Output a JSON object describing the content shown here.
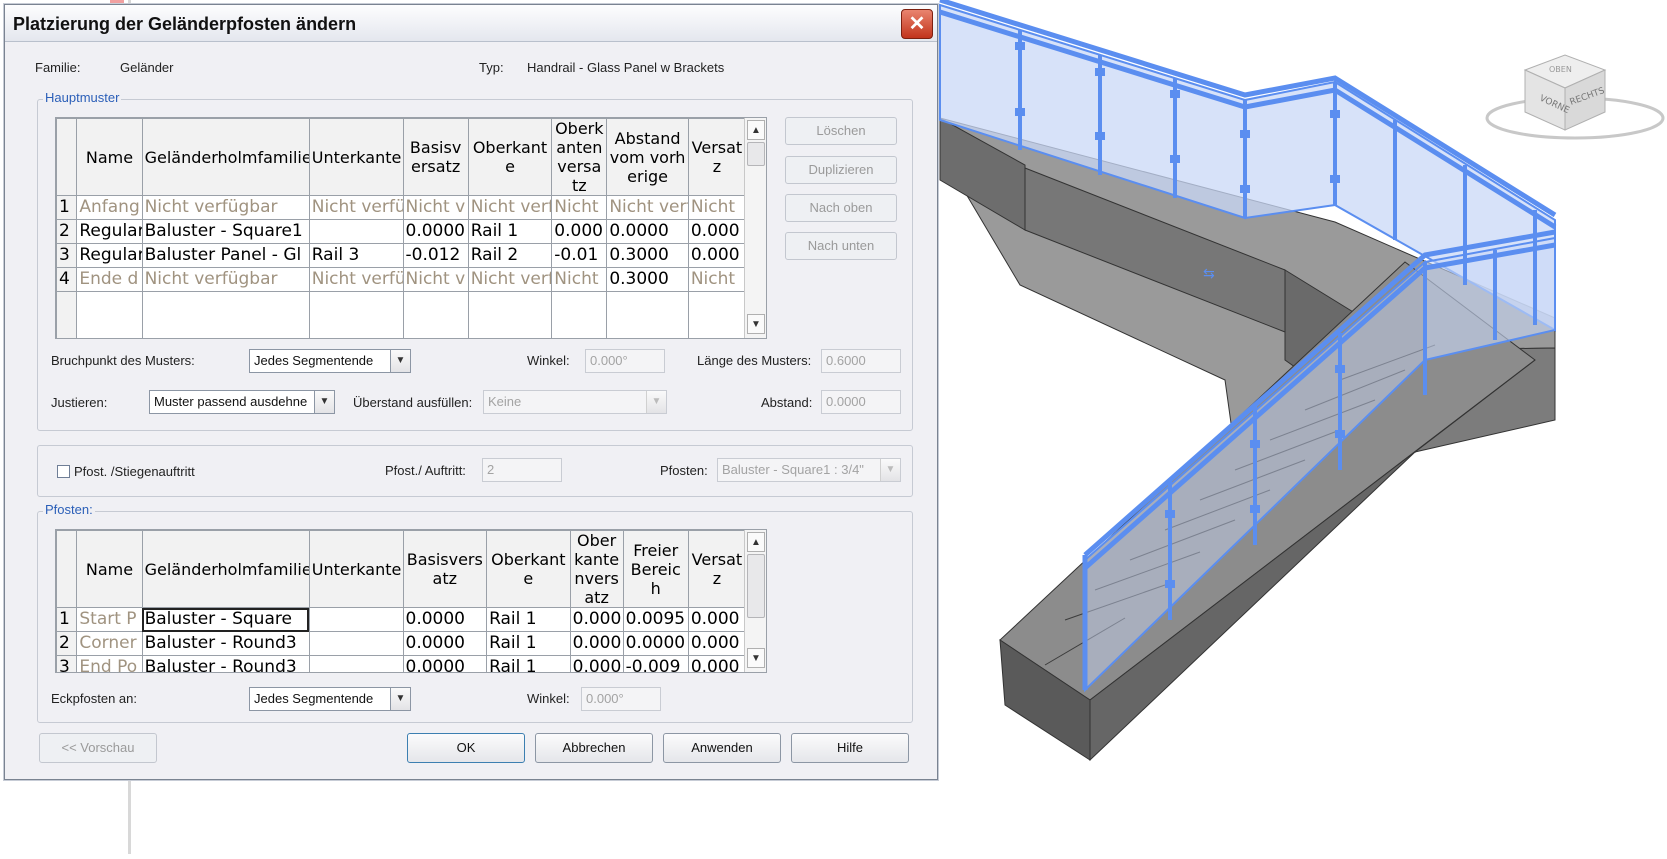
{
  "dialog": {
    "title": "Platzierung der Geländerpfosten ändern",
    "close_icon": "close-icon",
    "familie_label": "Familie:",
    "familie_value": "Geländer",
    "typ_label": "Typ:",
    "typ_value": "Handrail - Glass Panel w Brackets"
  },
  "hauptmuster": {
    "title": "Hauptmuster",
    "columns": [
      "",
      "Name",
      "Geländerholmfamilie",
      "Unterkante",
      "Basisversatz",
      "Oberkante",
      "Oberkantenversatz",
      "Abstand vom vorherige",
      "Versatz"
    ],
    "rows": [
      {
        "num": "1",
        "cells": [
          "Anfang",
          "Nicht verfügbar",
          "Nicht verfü",
          "Nicht v",
          "Nicht verf",
          "Nicht",
          "Nicht verf",
          "Nicht"
        ]
      },
      {
        "num": "2",
        "cells": [
          "Regular",
          "Baluster - Square1",
          "",
          "0.0000",
          "Rail 1",
          "0.000",
          "0.0000",
          "0.000"
        ]
      },
      {
        "num": "3",
        "cells": [
          "Regular",
          "Baluster Panel - Gl",
          "Rail 3",
          "-0.012",
          "Rail 2",
          "-0.01",
          "0.3000",
          "0.000"
        ]
      },
      {
        "num": "4",
        "cells": [
          "Ende d",
          "Nicht verfügbar",
          "Nicht verfü",
          "Nicht v",
          "Nicht verf",
          "Nicht",
          "0.3000",
          "Nicht"
        ]
      }
    ],
    "buttons": {
      "loeschen": "Löschen",
      "duplizieren": "Duplizieren",
      "nach_oben": "Nach oben",
      "nach_unten": "Nach unten"
    },
    "bruchpunkt_label": "Bruchpunkt des Musters:",
    "bruchpunkt_value": "Jedes Segmentende",
    "winkel_label": "Winkel:",
    "winkel_value": "0.000°",
    "laenge_label": "Länge des Musters:",
    "laenge_value": "0.6000",
    "justieren_label": "Justieren:",
    "justieren_value": "Muster passend ausdehne",
    "ueberstand_label": "Überstand ausfüllen:",
    "ueberstand_value": "Keine",
    "abstand_label": "Abstand:",
    "abstand_value": "0.0000"
  },
  "pfost_section": {
    "checkbox_label": "Pfost. /Stiegenauftritt",
    "checked": false,
    "pfost_auftritt_label": "Pfost./ Auftritt:",
    "pfost_auftritt_value": "2",
    "pfosten_label": "Pfosten:",
    "pfosten_value": "Baluster - Square1 : 3/4\""
  },
  "pfosten": {
    "title": "Pfosten:",
    "columns": [
      "",
      "Name",
      "Geländerholmfamilie",
      "Unterkante",
      "Basisversatz",
      "Oberkante",
      "Oberkantenversatz",
      "Freier Bereich",
      "Versatz"
    ],
    "rows": [
      {
        "num": "1",
        "cells": [
          "Start P",
          "Baluster - Square",
          "",
          "0.0000",
          "Rail 1",
          "0.000",
          "0.0095",
          "0.000"
        ]
      },
      {
        "num": "2",
        "cells": [
          "Corner",
          "Baluster - Round3",
          "",
          "0.0000",
          "Rail 1",
          "0.000",
          "0.0000",
          "0.000"
        ]
      },
      {
        "num": "3",
        "cells": [
          "End Po",
          "Baluster - Round3",
          "",
          "0.0000",
          "Rail 1",
          "0.000",
          "-0.009",
          "0.000"
        ]
      }
    ],
    "eckpfosten_label": "Eckpfosten an:",
    "eckpfosten_value": "Jedes Segmentende",
    "winkel_label": "Winkel:",
    "winkel_value": "0.000°"
  },
  "footer": {
    "vorschau": "<< Vorschau",
    "ok": "OK",
    "abbrechen": "Abbrechen",
    "anwenden": "Anwenden",
    "hilfe": "Hilfe"
  },
  "viewcube": {
    "front": "VORNE",
    "right": "RECHTS",
    "top": "OBEN"
  },
  "colors": {
    "selection_blue": "#5b8ef0",
    "glass": "#c9d8f7",
    "concrete_dark": "#5e5e5e",
    "concrete_mid": "#8a8a8a",
    "concrete_light": "#a9a9a9"
  }
}
